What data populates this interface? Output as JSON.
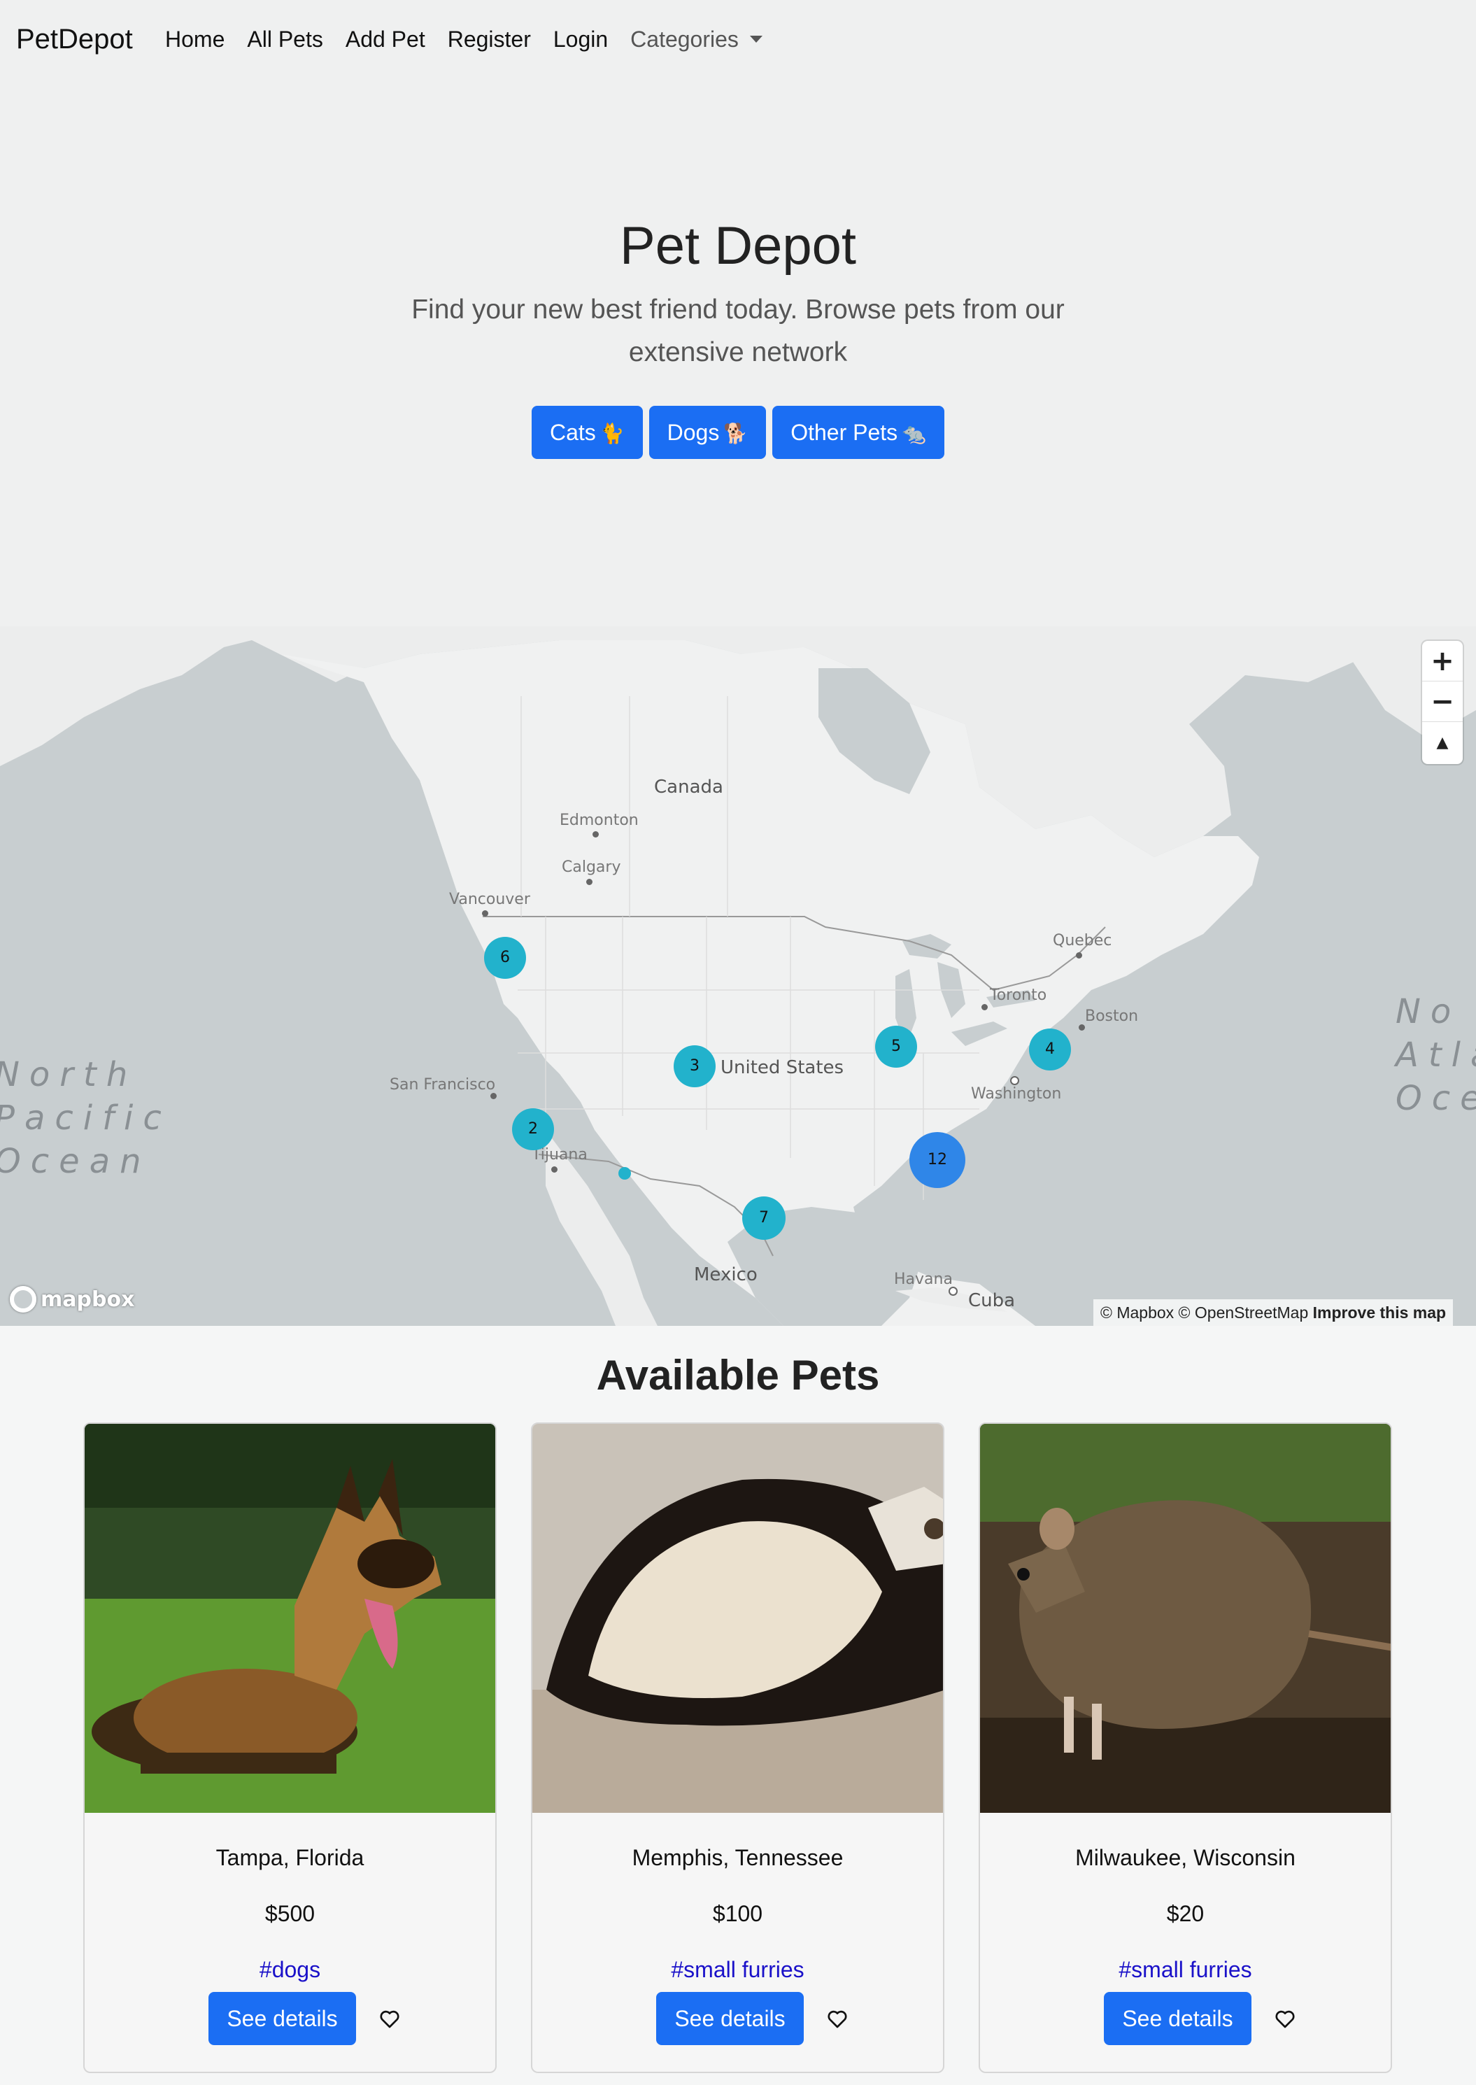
{
  "navbar": {
    "brand": "PetDepot",
    "links": [
      "Home",
      "All Pets",
      "Add Pet",
      "Register",
      "Login"
    ],
    "dropdown_label": "Categories"
  },
  "hero": {
    "title": "Pet Depot",
    "subtitle": "Find your new best friend today. Browse pets from our extensive network",
    "buttons": [
      {
        "label": "Cats",
        "emoji": "🐈"
      },
      {
        "label": "Dogs",
        "emoji": "🐕"
      },
      {
        "label": "Other Pets",
        "emoji": "🐀"
      }
    ]
  },
  "map": {
    "places": {
      "canada": "Canada",
      "edmonton": "Edmonton",
      "calgary": "Calgary",
      "vancouver": "Vancouver",
      "quebec": "Quebec",
      "toronto": "Toronto",
      "boston": "Boston",
      "washington": "Washington",
      "united_states": "United States",
      "san_francisco": "San Francisco",
      "tijuana": "Tijuana",
      "mexico": "Mexico",
      "havana": "Havana",
      "cuba": "Cuba"
    },
    "ocean_left": "North\nPacific\nOcean",
    "ocean_right": "No\nAtla\nOce",
    "clusters": {
      "pacific_nw": "6",
      "california": "2",
      "colorado": "3",
      "texas": "7",
      "midwest": "5",
      "northeast": "4",
      "southeast": "12"
    },
    "zoom_in": "+",
    "zoom_out": "−",
    "compass": "▲",
    "logo": "mapbox",
    "attribution": "© Mapbox © OpenStreetMap",
    "improve": "Improve this map"
  },
  "pets_section": {
    "title": "Available Pets",
    "details_label": "See details",
    "pets": [
      {
        "location": "Tampa, Florida",
        "price": "$500",
        "tag": "#dogs"
      },
      {
        "location": "Memphis, Tennessee",
        "price": "$100",
        "tag": "#small furries"
      },
      {
        "location": "Milwaukee, Wisconsin",
        "price": "$20",
        "tag": "#small furries"
      }
    ]
  }
}
